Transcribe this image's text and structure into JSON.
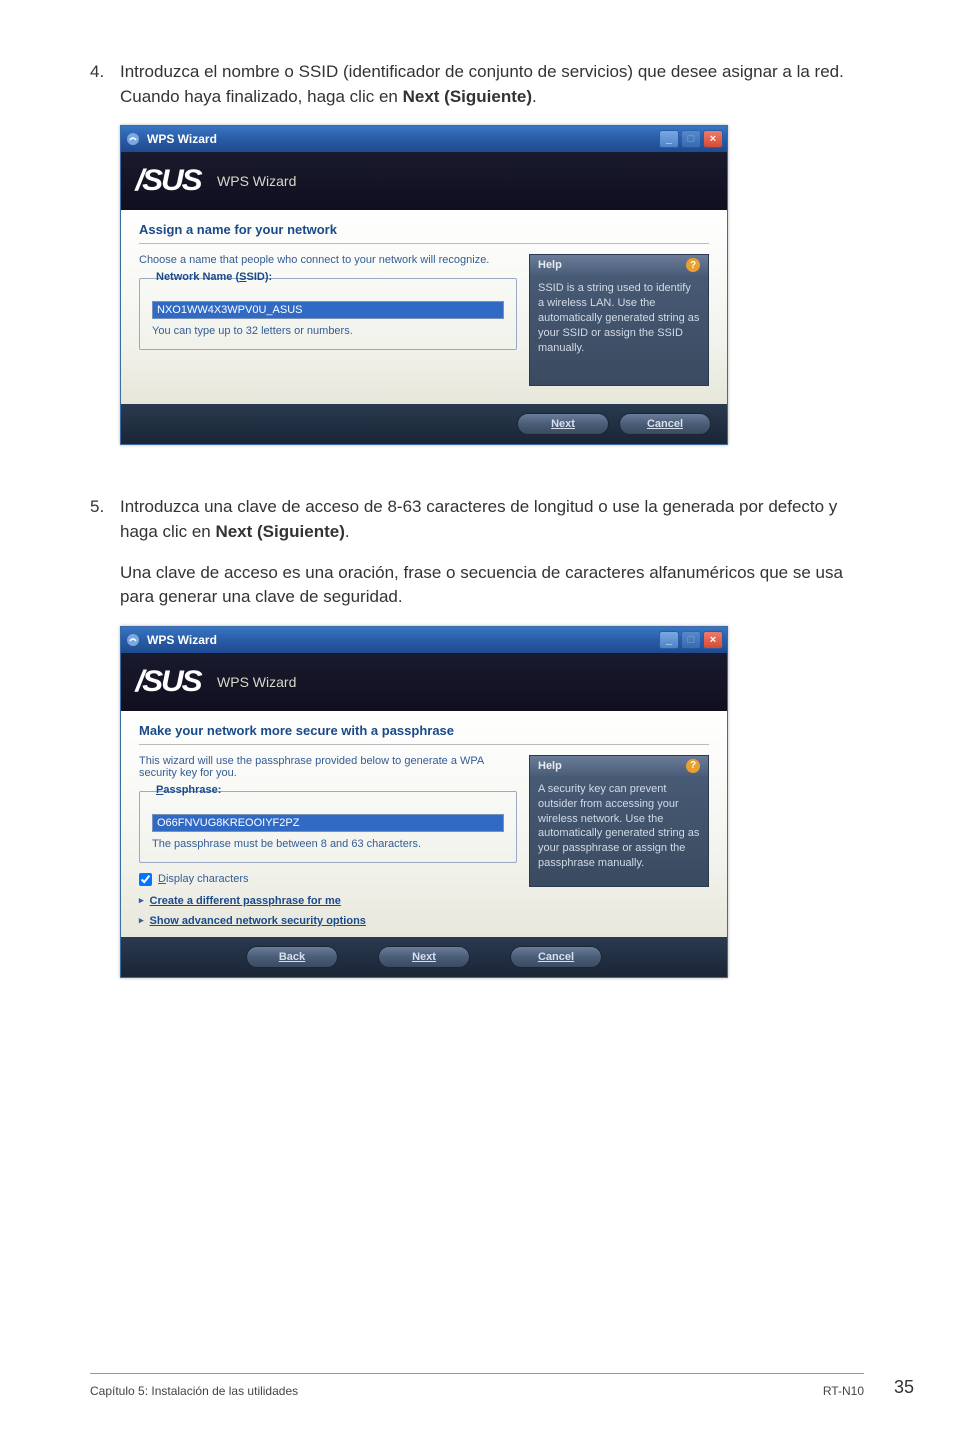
{
  "step4": {
    "num": "4.",
    "text_pre": "Introduzca el nombre o SSID (identificador de conjunto de servicios) que desee asignar a la red. Cuando haya finalizado, haga clic en ",
    "text_bold": "Next (Siguiente)",
    "text_post": "."
  },
  "dialog1": {
    "window_title": "WPS Wizard",
    "brand_title": "WPS Wizard",
    "step_title": "Assign a name for your network",
    "intro": "Choose a name that people who connect to your network will recognize.",
    "legend_prefix": "Network Name (",
    "legend_u": "S",
    "legend_suffix": "SID):",
    "input_value": "NXO1WW4X3WPV0U_ASUS",
    "hint": "You can type up to 32 letters or numbers.",
    "help_header": "Help",
    "help_body": "SSID is a string used to identify a wireless LAN. Use the automatically generated string as your SSID or assign the SSID manually.",
    "btn_next": "Next",
    "btn_cancel": "Cancel"
  },
  "step5": {
    "num": "5.",
    "text_pre": "Introduzca una clave de acceso de 8-63 caracteres de longitud o use la generada por defecto y haga clic en ",
    "text_bold": "Next (Siguiente)",
    "text_post": ".",
    "sub": "Una clave de acceso es una oración, frase o secuencia de caracteres alfanuméricos que se usa para generar una clave de seguridad."
  },
  "dialog2": {
    "window_title": "WPS Wizard",
    "brand_title": "WPS Wizard",
    "step_title": "Make your network more secure with a passphrase",
    "intro": "This wizard will use the passphrase provided below to generate a WPA security key for you.",
    "legend_u": "P",
    "legend_suffix": "assphrase:",
    "input_value": "O66FNVUG8KREOOIYF2PZ",
    "hint": "The passphrase must be between 8 and 63 characters.",
    "checkbox_u": "D",
    "checkbox_label": "isplay characters",
    "link1": "Create a different passphrase for me",
    "link2": "Show advanced network security options",
    "help_header": "Help",
    "help_body": "A security key can prevent outsider from accessing your wireless network. Use the automatically generated string as your passphrase or assign the passphrase manually.",
    "btn_back": "Back",
    "btn_next": "Next",
    "btn_cancel": "Cancel"
  },
  "footer": {
    "left": "Capítulo 5: Instalación de las utilidades",
    "right": "RT-N10"
  },
  "page_num": "35"
}
